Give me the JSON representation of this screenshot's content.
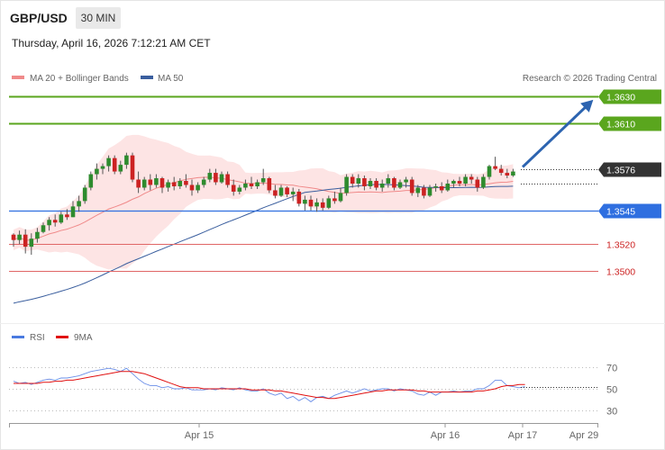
{
  "header": {
    "symbol": "GBP/USD",
    "timeframe": "30 MIN",
    "datetime": "Thursday, April 16, 2026 7:12:21 AM CET",
    "credit": "Research © 2026 Trading Central"
  },
  "legend": {
    "ma20": "MA 20 + Bollinger Bands",
    "ma50": "MA 50",
    "rsi": "RSI",
    "rsi_ma": "9MA"
  },
  "colors": {
    "resistance": "#5aa61e",
    "support_blue": "#2f6fe0",
    "support_red": "#e06666",
    "bull": "#2e8b2e",
    "bear": "#cc2222",
    "ma20": "#f08a8a",
    "ma50": "#3a5e9e",
    "band": "#fde1e1",
    "arrow": "#2d64b0",
    "current": "#333333"
  },
  "chart_data": {
    "type": "candlestick",
    "x_tick_labels": [
      "Apr 15",
      "Apr 16",
      "Apr 17",
      "Apr 29"
    ],
    "price_range": [
      1.348,
      1.3645
    ],
    "levels": [
      {
        "label": "1.3630",
        "value": 1.363,
        "kind": "resistance"
      },
      {
        "label": "1.3610",
        "value": 1.361,
        "kind": "resistance"
      },
      {
        "label": "1.3576",
        "value": 1.3576,
        "kind": "current"
      },
      {
        "label": "1.3545",
        "value": 1.3545,
        "kind": "support-strong"
      },
      {
        "label": "1.3520",
        "value": 1.352,
        "kind": "support"
      },
      {
        "label": "1.3500",
        "value": 1.35,
        "kind": "support"
      }
    ],
    "projection": {
      "from": 1.3576,
      "to": 1.363
    },
    "candles": [
      [
        1.3527,
        1.3528,
        1.3518,
        1.3523
      ],
      [
        1.3523,
        1.353,
        1.352,
        1.3527
      ],
      [
        1.3527,
        1.3531,
        1.3513,
        1.3518
      ],
      [
        1.3518,
        1.3528,
        1.3512,
        1.3524
      ],
      [
        1.3524,
        1.3532,
        1.3521,
        1.3529
      ],
      [
        1.3529,
        1.3536,
        1.3528,
        1.3534
      ],
      [
        1.3534,
        1.354,
        1.353,
        1.3538
      ],
      [
        1.3538,
        1.3542,
        1.3533,
        1.3536
      ],
      [
        1.3536,
        1.3544,
        1.3535,
        1.3542
      ],
      [
        1.3542,
        1.3546,
        1.3538,
        1.354
      ],
      [
        1.354,
        1.3552,
        1.354,
        1.3548
      ],
      [
        1.3548,
        1.3556,
        1.3544,
        1.3552
      ],
      [
        1.3552,
        1.3564,
        1.355,
        1.3562
      ],
      [
        1.3562,
        1.3574,
        1.356,
        1.3572
      ],
      [
        1.3572,
        1.358,
        1.3568,
        1.3576
      ],
      [
        1.3576,
        1.358,
        1.3572,
        1.3578
      ],
      [
        1.3578,
        1.3586,
        1.3574,
        1.3584
      ],
      [
        1.3584,
        1.3586,
        1.3572,
        1.3574
      ],
      [
        1.3574,
        1.3582,
        1.3572,
        1.3579
      ],
      [
        1.3579,
        1.3588,
        1.3576,
        1.3586
      ],
      [
        1.3586,
        1.3588,
        1.3566,
        1.3568
      ],
      [
        1.3568,
        1.3574,
        1.3558,
        1.3562
      ],
      [
        1.3562,
        1.357,
        1.356,
        1.3568
      ],
      [
        1.3568,
        1.3572,
        1.356,
        1.3564
      ],
      [
        1.3564,
        1.3572,
        1.3562,
        1.3569
      ],
      [
        1.3569,
        1.357,
        1.3558,
        1.3562
      ],
      [
        1.3562,
        1.3568,
        1.3559,
        1.3566
      ],
      [
        1.3566,
        1.357,
        1.356,
        1.3563
      ],
      [
        1.3563,
        1.3569,
        1.3561,
        1.3567
      ],
      [
        1.3567,
        1.3572,
        1.3562,
        1.3564
      ],
      [
        1.3564,
        1.3568,
        1.3556,
        1.356
      ],
      [
        1.356,
        1.3566,
        1.3558,
        1.3564
      ],
      [
        1.3564,
        1.357,
        1.3562,
        1.3568
      ],
      [
        1.3568,
        1.3576,
        1.3566,
        1.3573
      ],
      [
        1.3573,
        1.3576,
        1.3564,
        1.3566
      ],
      [
        1.3566,
        1.3574,
        1.3565,
        1.3572
      ],
      [
        1.3572,
        1.3574,
        1.3562,
        1.3564
      ],
      [
        1.3564,
        1.3568,
        1.3556,
        1.3559
      ],
      [
        1.3559,
        1.3564,
        1.3557,
        1.3562
      ],
      [
        1.3562,
        1.3568,
        1.356,
        1.3565
      ],
      [
        1.3565,
        1.357,
        1.3561,
        1.3563
      ],
      [
        1.3563,
        1.3568,
        1.3561,
        1.3566
      ],
      [
        1.3566,
        1.3576,
        1.3564,
        1.3569
      ],
      [
        1.3569,
        1.357,
        1.3558,
        1.356
      ],
      [
        1.356,
        1.3564,
        1.3554,
        1.3556
      ],
      [
        1.3556,
        1.3564,
        1.3555,
        1.3562
      ],
      [
        1.3562,
        1.3563,
        1.3555,
        1.3557
      ],
      [
        1.3557,
        1.3562,
        1.3552,
        1.3559
      ],
      [
        1.3559,
        1.3561,
        1.3548,
        1.355
      ],
      [
        1.355,
        1.3556,
        1.3545,
        1.3553
      ],
      [
        1.3553,
        1.3556,
        1.3545,
        1.3548
      ],
      [
        1.3548,
        1.3554,
        1.3544,
        1.3551
      ],
      [
        1.3551,
        1.3554,
        1.3545,
        1.3547
      ],
      [
        1.3547,
        1.3556,
        1.3546,
        1.3554
      ],
      [
        1.3554,
        1.3559,
        1.355,
        1.3552
      ],
      [
        1.3552,
        1.3562,
        1.3551,
        1.3558
      ],
      [
        1.3558,
        1.3572,
        1.3556,
        1.357
      ],
      [
        1.357,
        1.3572,
        1.3562,
        1.3565
      ],
      [
        1.3565,
        1.3572,
        1.3562,
        1.3569
      ],
      [
        1.3569,
        1.3571,
        1.356,
        1.3563
      ],
      [
        1.3563,
        1.3569,
        1.3561,
        1.3567
      ],
      [
        1.3567,
        1.3569,
        1.356,
        1.3562
      ],
      [
        1.3562,
        1.3568,
        1.3559,
        1.3565
      ],
      [
        1.3565,
        1.3572,
        1.3562,
        1.3569
      ],
      [
        1.3569,
        1.357,
        1.356,
        1.3562
      ],
      [
        1.3562,
        1.3568,
        1.3561,
        1.3566
      ],
      [
        1.3566,
        1.357,
        1.3562,
        1.3568
      ],
      [
        1.3568,
        1.357,
        1.3556,
        1.3558
      ],
      [
        1.3558,
        1.3564,
        1.3555,
        1.3562
      ],
      [
        1.3562,
        1.3564,
        1.3554,
        1.3556
      ],
      [
        1.3556,
        1.3564,
        1.3555,
        1.3562
      ],
      [
        1.3562,
        1.3565,
        1.3559,
        1.3563
      ],
      [
        1.3563,
        1.3566,
        1.3558,
        1.356
      ],
      [
        1.356,
        1.3568,
        1.3559,
        1.3565
      ],
      [
        1.3565,
        1.3568,
        1.3562,
        1.3567
      ],
      [
        1.3567,
        1.357,
        1.3563,
        1.3565
      ],
      [
        1.3565,
        1.3572,
        1.3563,
        1.357
      ],
      [
        1.357,
        1.3572,
        1.3565,
        1.3568
      ],
      [
        1.3568,
        1.357,
        1.3559,
        1.3562
      ],
      [
        1.3562,
        1.3572,
        1.3561,
        1.357
      ],
      [
        1.357,
        1.3579,
        1.3568,
        1.3578
      ],
      [
        1.3578,
        1.3585,
        1.3575,
        1.3576
      ],
      [
        1.3576,
        1.3579,
        1.3571,
        1.3573
      ],
      [
        1.3573,
        1.3576,
        1.3569,
        1.3571
      ],
      [
        1.3571,
        1.3576,
        1.357,
        1.3574
      ]
    ],
    "rsi": {
      "ticks": [
        "70",
        "50",
        "30"
      ],
      "range": [
        20,
        80
      ],
      "values": [
        57,
        55,
        56,
        54,
        56,
        58,
        59,
        58,
        60,
        60,
        61,
        62,
        64,
        66,
        67,
        68,
        69,
        68,
        66,
        69,
        64,
        59,
        55,
        53,
        53,
        51,
        52,
        50,
        50,
        51,
        49,
        49,
        49,
        50,
        49,
        51,
        50,
        49,
        51,
        49,
        48,
        48,
        50,
        46,
        44,
        46,
        41,
        43,
        39,
        42,
        38,
        42,
        43,
        41,
        44,
        46,
        48,
        46,
        48,
        50,
        48,
        49,
        50,
        50,
        48,
        50,
        49,
        48,
        45,
        44,
        47,
        44,
        47,
        47,
        48,
        47,
        48,
        48,
        50,
        50,
        53,
        58,
        58,
        53,
        52,
        51,
        52
      ],
      "ma_values": [
        55,
        55,
        55,
        55,
        55,
        56,
        56,
        57,
        57,
        58,
        58,
        59,
        60,
        61,
        62,
        63,
        64,
        65,
        66,
        66,
        66,
        65,
        64,
        62,
        60,
        58,
        56,
        54,
        52,
        51,
        51,
        51,
        50,
        50,
        50,
        50,
        50,
        50,
        50,
        50,
        49,
        49,
        49,
        49,
        48,
        48,
        47,
        46,
        45,
        44,
        43,
        42,
        42,
        41,
        41,
        42,
        43,
        44,
        45,
        46,
        47,
        48,
        48,
        49,
        49,
        49,
        49,
        49,
        48,
        48,
        47,
        47,
        47,
        47,
        47,
        47,
        47,
        47,
        48,
        48,
        49,
        50,
        52,
        53,
        53,
        54,
        54
      ]
    }
  }
}
